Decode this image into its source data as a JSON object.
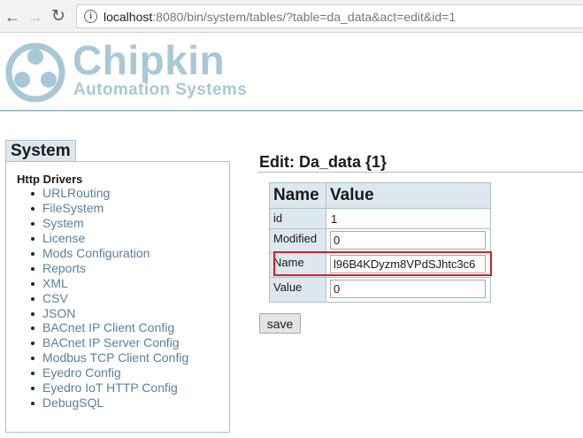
{
  "browser": {
    "url_host": "localhost",
    "url_rest": ":8080/bin/system/tables/?table=da_data&act=edit&id=1"
  },
  "header": {
    "brand_name": "Chipkin",
    "brand_subtitle": "Automation Systems"
  },
  "sidebar": {
    "tab_label": "System",
    "heading": "Http Drivers",
    "items": [
      "URLRouting",
      "FileSystem",
      "System",
      "License",
      "Mods Configuration",
      "Reports",
      "XML",
      "CSV",
      "JSON",
      "BACnet IP Client Config",
      "BACnet IP Server Config",
      "Modbus TCP Client Config",
      "Eyedro Config",
      "Eyedro IoT HTTP Config",
      "DebugSQL"
    ]
  },
  "main": {
    "title": "Edit: Da_data {1}",
    "table": {
      "col_name": "Name",
      "col_value": "Value",
      "rows": [
        {
          "key": "id",
          "value": "1"
        },
        {
          "key": "Modified",
          "value": "0"
        },
        {
          "key": "Name",
          "value": "l96B4KDyzm8VPdSJhtc3c6"
        },
        {
          "key": "Value",
          "value": "0"
        }
      ]
    },
    "save_label": "save"
  },
  "colors": {
    "accent": "#a9c8d6",
    "link": "#5a7f9e",
    "highlight": "#d11f2a",
    "table_header_bg": "#dde8ee"
  }
}
